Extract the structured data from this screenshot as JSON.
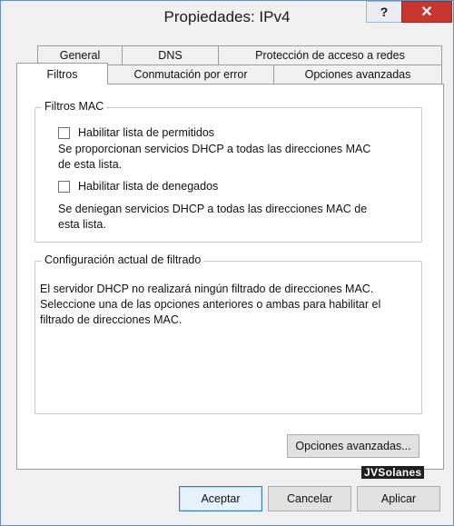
{
  "window": {
    "title": "Propiedades: IPv4",
    "help_label": "?",
    "close_label": "✕"
  },
  "tabs": {
    "row_back": [
      "General",
      "DNS",
      "Protección de acceso a redes"
    ],
    "row_front": [
      "Filtros",
      "Conmutación por error",
      "Opciones avanzadas"
    ],
    "active": "Filtros"
  },
  "mac_filters": {
    "legend": "Filtros MAC",
    "allow": {
      "label": "Habilitar lista de permitidos",
      "checked": false,
      "desc_line1": "Se proporcionan servicios DHCP a todas las direcciones MAC",
      "desc_line2": "de esta lista."
    },
    "deny": {
      "label": "Habilitar lista de denegados",
      "checked": false,
      "desc_line1": "Se deniegan servicios DHCP a todas las direcciones MAC de",
      "desc_line2": "esta lista."
    }
  },
  "current_config": {
    "legend": "Configuración actual de filtrado",
    "line1": "El servidor DHCP no realizará ningún filtrado de direcciones MAC.",
    "line2": "Seleccione una de las opciones anteriores o ambas para habilitar el",
    "line3": "filtrado de direcciones MAC."
  },
  "advanced_button": "Opciones avanzadas...",
  "watermark": "JVSolanes",
  "footer": {
    "ok": "Aceptar",
    "cancel": "Cancelar",
    "apply": "Aplicar"
  }
}
